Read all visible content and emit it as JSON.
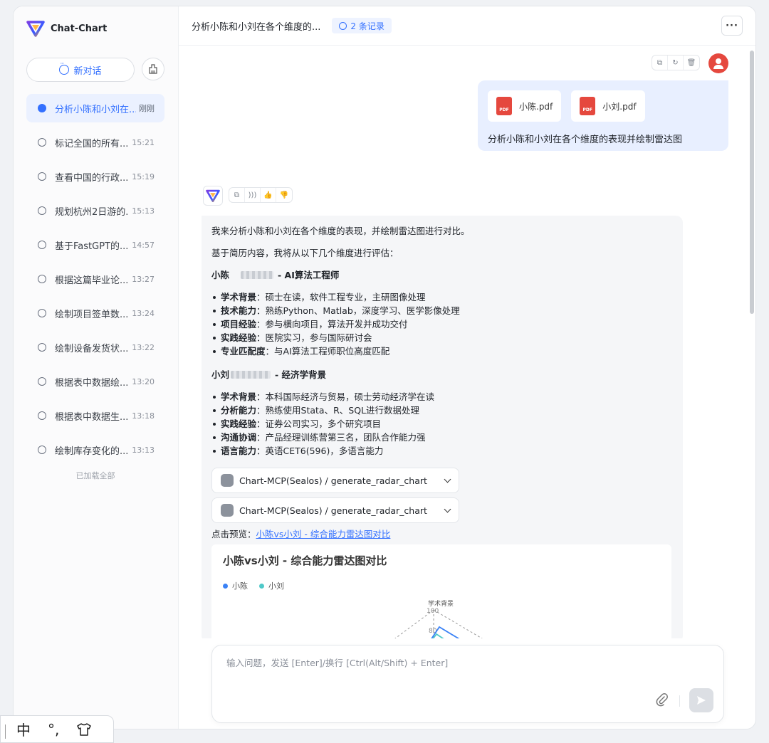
{
  "sidebar": {
    "app_name": "Chat-Chart",
    "new_chat_label": "新对话",
    "history": [
      {
        "title": "分析小陈和小刘在...",
        "time": "刚刚",
        "active": true
      },
      {
        "title": "标记全国的所有...",
        "time": "15:21"
      },
      {
        "title": "查看中国的行政...",
        "time": "15:19"
      },
      {
        "title": "规划杭州2日游的...",
        "time": "15:13"
      },
      {
        "title": "基于FastGPT的...",
        "time": "14:57"
      },
      {
        "title": "根据这篇毕业论...",
        "time": "13:27"
      },
      {
        "title": "绘制项目签单数...",
        "time": "13:24"
      },
      {
        "title": "绘制设备发货状...",
        "time": "13:22"
      },
      {
        "title": "根据表中数据绘...",
        "time": "13:20"
      },
      {
        "title": "根据表中数据生...",
        "time": "13:18"
      },
      {
        "title": "绘制库存变化的...",
        "time": "13:13"
      }
    ],
    "loaded_all": "已加载全部"
  },
  "header": {
    "title": "分析小陈和小刘在各个维度的...",
    "record_badge": "2 条记录",
    "more_label": "···"
  },
  "user_message": {
    "files": [
      "小陈.pdf",
      "小刘.pdf"
    ],
    "file_type": "PDF",
    "text": "分析小陈和小刘在各个维度的表现并绘制雷达图"
  },
  "bot_message": {
    "intro": "我来分析小陈和小刘在各个维度的表现，并绘制雷达图进行对比。",
    "basis": "基于简历内容，我将从以下几个维度进行评估：",
    "person1": {
      "name": "小陈",
      "role": "- AI算法工程师",
      "items": [
        {
          "k": "学术背景",
          "v": "：硕士在读，软件工程专业，主研图像处理"
        },
        {
          "k": "技术能力",
          "v": "：熟练Python、Matlab，深度学习、医学影像处理"
        },
        {
          "k": "项目经验",
          "v": "：参与横向项目，算法开发并成功交付"
        },
        {
          "k": "实践经验",
          "v": "：医院实习，参与国际研讨会"
        },
        {
          "k": "专业匹配度",
          "v": "：与AI算法工程师职位高度匹配"
        }
      ]
    },
    "person2": {
      "name": "小刘",
      "role": "- 经济学背景",
      "items": [
        {
          "k": "学术背景",
          "v": "：本科国际经济与贸易，硕士劳动经济学在读"
        },
        {
          "k": "分析能力",
          "v": "：熟练使用Stata、R、SQL进行数据处理"
        },
        {
          "k": "实践经验",
          "v": "：证券公司实习，多个研究项目"
        },
        {
          "k": "沟通协调",
          "v": "：产品经理训练营第三名，团队合作能力强"
        },
        {
          "k": "语言能力",
          "v": "：英语CET6(596)，多语言能力"
        }
      ]
    },
    "tool_calls": [
      "Chart-MCP(Sealos) / generate_radar_chart",
      "Chart-MCP(Sealos) / generate_radar_chart"
    ],
    "preview_prefix": "点击预览：",
    "preview_link": "小陈vs小刘 - 综合能力雷达图对比"
  },
  "chart_data": {
    "type": "radar",
    "title": "小陈vs小刘 - 综合能力雷达图对比",
    "series": [
      {
        "name": "小陈",
        "color": "#3b82f6"
      },
      {
        "name": "小刘",
        "color": "#4fc9c9"
      }
    ],
    "visible_axis_label": "学术背景",
    "visible_ticks": [
      "100",
      "80"
    ]
  },
  "input": {
    "placeholder": "输入问题，发送 [Enter]/换行 [Ctrl(Alt/Shift) + Enter]"
  },
  "ime": {
    "mode": "中",
    "punct": "°,"
  }
}
